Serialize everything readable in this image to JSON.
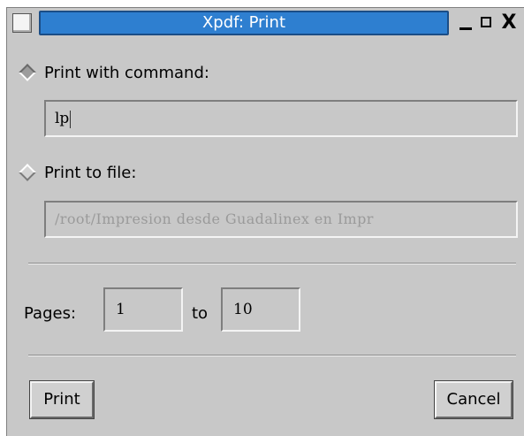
{
  "window": {
    "title": "Xpdf: Print",
    "minimize_glyph": "_",
    "maximize_glyph": "□",
    "close_glyph": "X"
  },
  "print_command": {
    "label": "Print with command:",
    "value": "lp",
    "selected": true
  },
  "print_file": {
    "label": "Print to file:",
    "value": "/root/Impresion desde Guadalinex en Impr",
    "selected": false
  },
  "pages": {
    "label": "Pages:",
    "from": "1",
    "to_label": "to",
    "to": "10"
  },
  "buttons": {
    "print": "Print",
    "cancel": "Cancel"
  },
  "colors": {
    "titlebar_accent": "#2e7fd0",
    "window_bg": "#c8c8c8",
    "disabled_text": "#9a9a9a"
  }
}
